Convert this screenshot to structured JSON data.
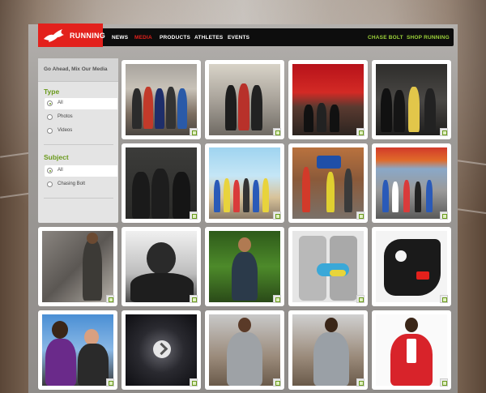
{
  "brand": {
    "name": "RUNNING",
    "color": "#e3211c"
  },
  "nav": {
    "items": [
      "NEWS",
      "MEDIA",
      "PRODUCTS",
      "ATHLETES",
      "EVENTS"
    ],
    "active": "MEDIA",
    "right_items": [
      "CHASE BOLT",
      "SHOP RUNNING"
    ],
    "accent": "#9dd33a"
  },
  "sidebar": {
    "title": "Go Ahead, Mix Our Media",
    "type": {
      "label": "Type",
      "options": [
        "All",
        "Photos",
        "Videos"
      ],
      "selected": "All"
    },
    "subject": {
      "label": "Subject",
      "options": [
        "All",
        "Chasing Bolt"
      ],
      "selected": "All"
    }
  },
  "gallery": {
    "tiles": [
      {
        "icon": "photo-icon"
      },
      {
        "icon": "photo-icon"
      },
      {
        "icon": "photo-icon"
      },
      {
        "icon": "photo-icon"
      },
      {
        "icon": "photo-icon"
      },
      {
        "icon": "photo-icon"
      },
      {
        "icon": "photo-icon"
      },
      {
        "icon": "photo-icon"
      },
      {
        "icon": "photo-icon"
      },
      {
        "icon": "photo-icon"
      },
      {
        "icon": "photo-icon"
      },
      {
        "icon": "photo-icon"
      },
      {
        "icon": "photo-icon"
      },
      {
        "icon": "photo-icon"
      },
      {
        "icon": "photo-icon"
      },
      {
        "icon": "photo-icon"
      },
      {
        "icon": "photo-icon"
      },
      {
        "icon": "photo-icon"
      }
    ]
  }
}
